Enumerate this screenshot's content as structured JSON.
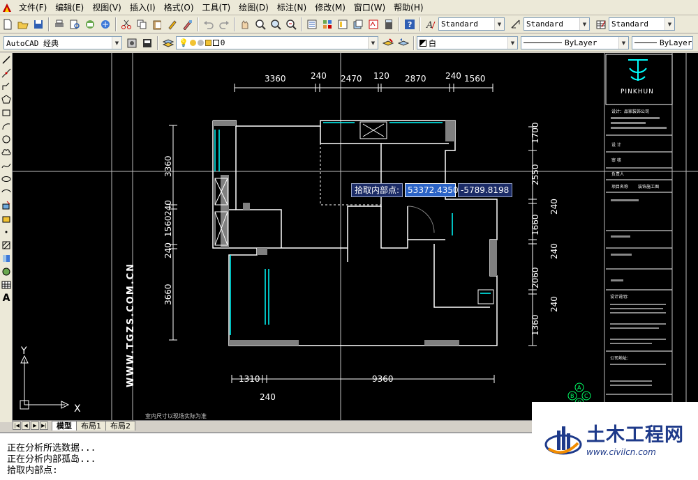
{
  "menus": [
    "文件(F)",
    "编辑(E)",
    "视图(V)",
    "插入(I)",
    "格式(O)",
    "工具(T)",
    "绘图(D)",
    "标注(N)",
    "修改(M)",
    "窗口(W)",
    "帮助(H)"
  ],
  "toolbar": {
    "text_style": "Standard",
    "dim_style": "Standard",
    "table_style": "Standard",
    "workspace": "AutoCAD 经典",
    "layer": "0",
    "color": "白",
    "linetype": "ByLayer",
    "lineweight": "ByLayer"
  },
  "tabs": [
    "模型",
    "布局1",
    "布局2"
  ],
  "command_lines": [
    "正在分析所选数据...",
    "正在分析内部孤岛...",
    "拾取内部点:"
  ],
  "pick_prompt": {
    "label": "拾取内部点:",
    "x_value": "53372.4350",
    "y_value": "-5789.8198"
  },
  "drawing": {
    "top_dims": [
      "3360",
      "240",
      "2470",
      "120",
      "2870",
      "240",
      "1560"
    ],
    "left_dims": [
      "3360",
      "240",
      "1560",
      "240",
      "3660"
    ],
    "right_dims": [
      "1700",
      "2550",
      "240",
      "1660",
      "240",
      "2060",
      "240",
      "1360"
    ],
    "bottom_dims": [
      "1310",
      "9360",
      "240"
    ],
    "vertical_watermark": "WWW.TGZS.COM.CN",
    "ucs_x": "X",
    "ucs_y": "Y",
    "bottom_note": "室内尺寸以现场实际为准",
    "title_block": {
      "brand": "PINKHUN",
      "company": "设计：品家装饰公司",
      "row_labels": [
        "设 计",
        "审 核",
        "负责人",
        "项目名称"
      ],
      "project_name": "装饰施工图",
      "notes_head": "设计说明：",
      "address_head": "公司地址：",
      "compass_labels": [
        "A",
        "B",
        "C",
        "D"
      ]
    }
  },
  "logo": {
    "name": "土木工程网",
    "url": "www.civilcn.com"
  },
  "colors": {
    "canvas_bg": "#000000",
    "wall": "#ffffff",
    "window": "#00ffff",
    "pick_highlight": "#2b63c6",
    "logo_text": "#1e3a8a"
  }
}
